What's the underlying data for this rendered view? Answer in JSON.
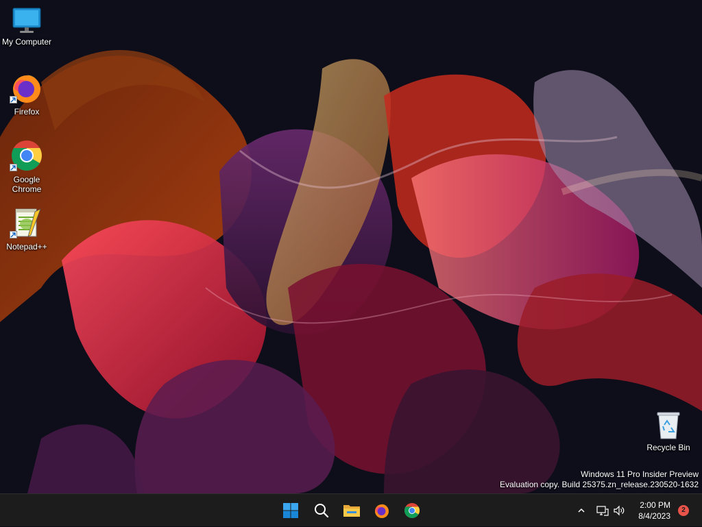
{
  "desktop": {
    "icons": [
      {
        "label": "My Computer"
      },
      {
        "label": "Firefox"
      },
      {
        "label": "Google\nChrome"
      },
      {
        "label": "Notepad++"
      },
      {
        "label": "Recycle Bin"
      }
    ],
    "watermark": {
      "line1": "Windows 11 Pro Insider Preview",
      "line2": "Evaluation copy. Build 25375.zn_release.230520-1632"
    }
  },
  "taskbar": {
    "apps": [
      {
        "icon": "windows-start-icon"
      },
      {
        "icon": "search-icon"
      },
      {
        "icon": "file-explorer-icon"
      },
      {
        "icon": "firefox-icon"
      },
      {
        "icon": "chrome-icon"
      }
    ],
    "tray": {
      "time": "2:00 PM",
      "date": "8/4/2023",
      "notification_count": "2"
    }
  },
  "colors": {
    "taskbar_bg": "#1c1c1c",
    "accent": "#0078d4",
    "badge": "#e8534a"
  }
}
